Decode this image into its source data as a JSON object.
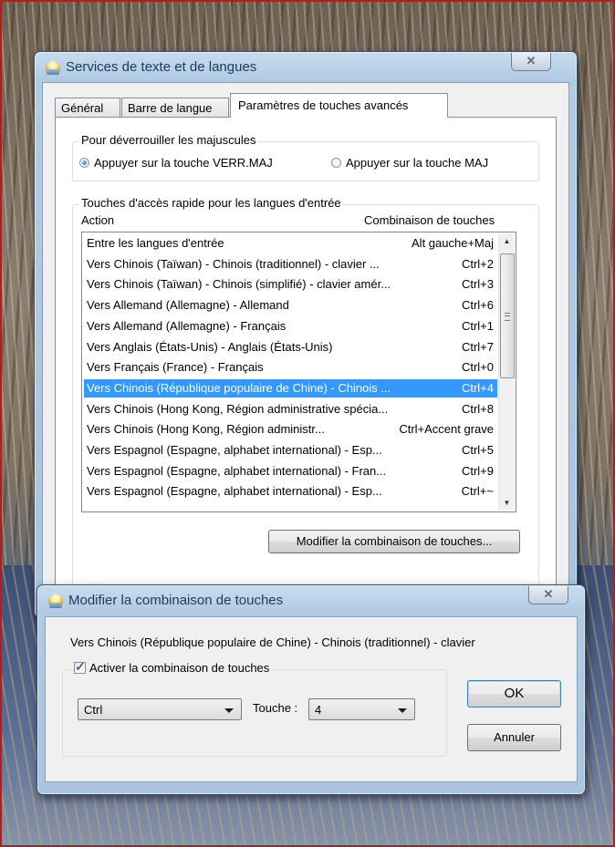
{
  "main_dialog": {
    "title": "Services de texte et de langues",
    "close_glyph": "✕",
    "tabs": [
      {
        "label": "Général"
      },
      {
        "label": "Barre de langue"
      },
      {
        "label": "Paramètres de touches avancés",
        "active": true
      }
    ],
    "caps_group": {
      "legend": "Pour déverrouiller les majuscules",
      "options": [
        {
          "label": "Appuyer sur la touche VERR.MAJ",
          "selected": true
        },
        {
          "label": "Appuyer sur la touche MAJ",
          "selected": false
        }
      ]
    },
    "hotkeys_group": {
      "legend": "Touches d'accès rapide pour les langues d'entrée",
      "col_action": "Action",
      "col_combo": "Combinaison de touches",
      "rows": [
        {
          "action": "Entre les langues d'entrée",
          "keys": "Alt gauche+Maj"
        },
        {
          "action": "Vers Chinois (Taïwan) - Chinois (traditionnel) - clavier ...",
          "keys": "Ctrl+2"
        },
        {
          "action": "Vers Chinois (Taïwan) - Chinois (simplifié) - clavier amér...",
          "keys": "Ctrl+3"
        },
        {
          "action": "Vers Allemand (Allemagne) - Allemand",
          "keys": "Ctrl+6"
        },
        {
          "action": "Vers Allemand (Allemagne) - Français",
          "keys": "Ctrl+1"
        },
        {
          "action": "Vers Anglais (États-Unis) - Anglais (États-Unis)",
          "keys": "Ctrl+7"
        },
        {
          "action": "Vers Français (France) - Français",
          "keys": "Ctrl+0"
        },
        {
          "action": "Vers Chinois (République populaire de Chine) - Chinois ...",
          "keys": "Ctrl+4",
          "selected": true
        },
        {
          "action": "Vers Chinois (Hong Kong, Région administrative spécia...",
          "keys": "Ctrl+8"
        },
        {
          "action": "Vers Chinois (Hong Kong, Région administr...",
          "keys": "Ctrl+Accent grave"
        },
        {
          "action": "Vers Espagnol (Espagne, alphabet international) - Esp...",
          "keys": "Ctrl+5"
        },
        {
          "action": "Vers Espagnol (Espagne, alphabet international) - Fran...",
          "keys": "Ctrl+9"
        },
        {
          "action": "Vers Espagnol (Espagne, alphabet international) - Esp...",
          "keys": "Ctrl+~"
        }
      ],
      "change_button": "Modifier la combinaison de touches..."
    }
  },
  "sub_dialog": {
    "title": "Modifier la combinaison de touches",
    "close_glyph": "✕",
    "description": "Vers Chinois (République populaire de Chine) - Chinois (traditionnel) - clavier",
    "enable_checkbox": {
      "label": "Activer la combinaison de touches",
      "checked": true
    },
    "modifier_value": "Ctrl",
    "key_label": "Touche :",
    "key_value": "4",
    "ok_button": "OK",
    "cancel_button": "Annuler"
  },
  "scrollbar": {
    "up_glyph": "▲",
    "down_glyph": "▼"
  }
}
